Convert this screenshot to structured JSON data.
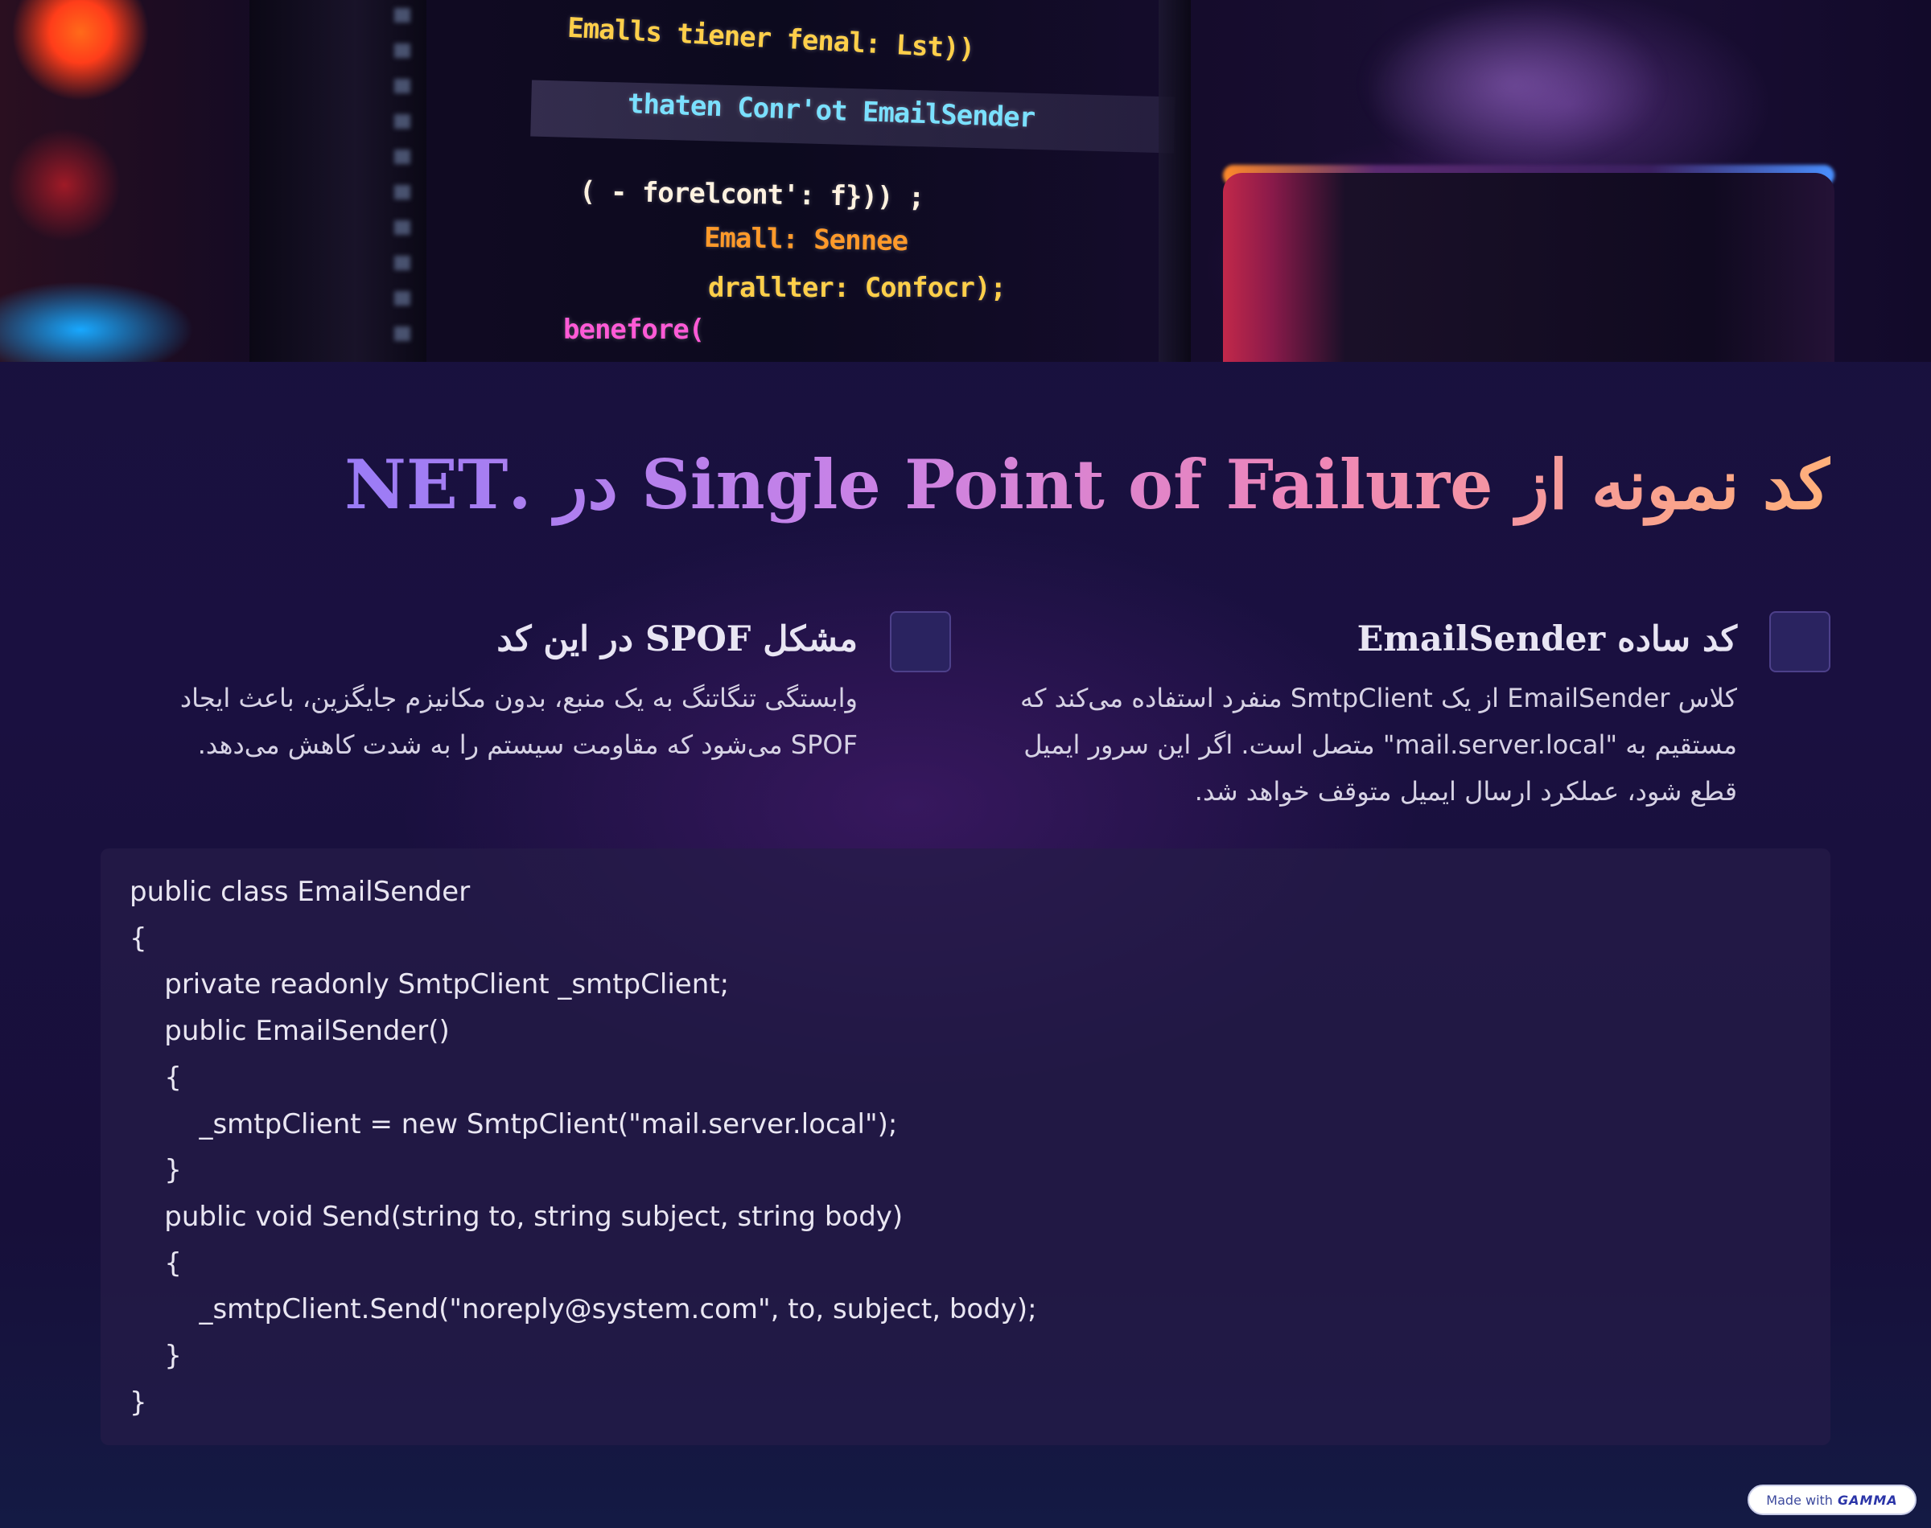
{
  "hero": {
    "code_lines": [
      "Emalls tiener fenal: Lst))",
      "thaten Conr'ot EmailSender",
      "( - forelcont': f})) ;",
      "Emall: Sennee",
      "drallter: Confocr);",
      "benefore("
    ]
  },
  "title": "کد نمونه از Single Point of Failure در .NET",
  "features": [
    {
      "heading": "کد ساده EmailSender",
      "text": "کلاس EmailSender از یک SmtpClient منفرد استفاده می‌کند که مستقیم به \"mail.server.local\" متصل است. اگر این سرور ایمیل قطع شود، عملکرد ارسال ایمیل متوقف خواهد شد."
    },
    {
      "heading": "مشکل SPOF در این کد",
      "text": "وابستگی تنگاتنگ به یک منبع، بدون مکانیزم جایگزین، باعث ایجاد SPOF می‌شود که مقاومت سیستم را به شدت کاهش می‌دهد."
    }
  ],
  "code": [
    "public class EmailSender",
    "{",
    "    private readonly SmtpClient _smtpClient;",
    "    public EmailSender()",
    "    {",
    "        _smtpClient = new SmtpClient(\"mail.server.local\");",
    "    }",
    "    public void Send(string to, string subject, string body)",
    "    {",
    "        _smtpClient.Send(\"noreply@system.com\", to, subject, body);",
    "    }",
    "}"
  ],
  "badge": {
    "prefix": "Made with",
    "brand": "GAMMA"
  }
}
